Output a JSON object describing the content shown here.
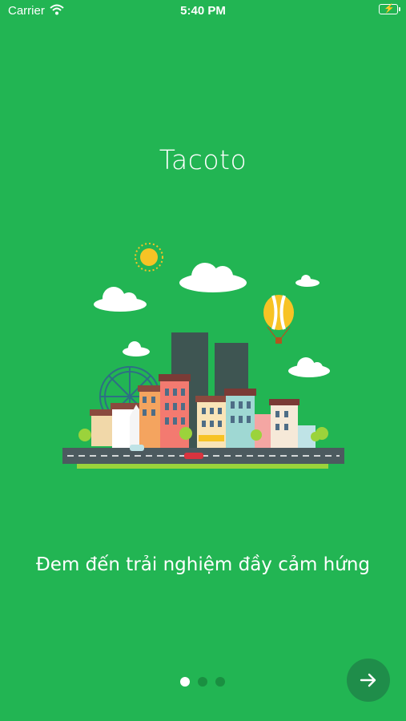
{
  "status_bar": {
    "carrier": "Carrier",
    "time": "5:40 PM"
  },
  "onboarding": {
    "title": "Tacoto",
    "tagline": "Đem đến trải nghiệm đầy cảm hứng",
    "page_index": 1,
    "page_count": 3
  },
  "colors": {
    "background": "#22b553",
    "next_button": "#1f8d4a",
    "dot_inactive": "#1a8f41"
  },
  "icons": {
    "next": "arrow-right-icon",
    "wifi": "wifi-icon",
    "battery": "battery-charging-icon"
  }
}
